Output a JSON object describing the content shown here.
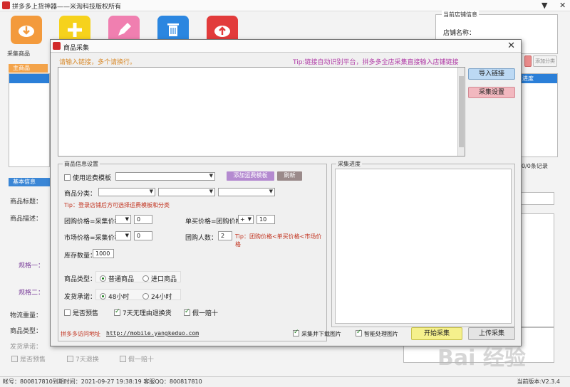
{
  "app": {
    "title": "拼多多上货神器——米淘科技版权所有",
    "minimize_glyph": "▼",
    "close_glyph": "✕"
  },
  "toolbar": {
    "collect_label": "采集商品",
    "colors": {
      "orange": "#f39a3c",
      "yellow": "#f6d21c",
      "pink": "#f07fb0",
      "blue": "#2b86e0",
      "red": "#e23b3b"
    }
  },
  "store_panel": {
    "legend": "当前店铺信息",
    "store_name_label": "店铺名称：",
    "side_btn": "添加分类"
  },
  "left_panel": {
    "tab": "主商品",
    "tab2": "基本信息",
    "labels": {
      "title": "商品标题：",
      "desc": "商品描述：",
      "spec1": "规格一：",
      "spec2": "规格二：",
      "weight": "物流重量：",
      "type": "商品类型：",
      "promise": "发货承诺："
    },
    "bottom_options": [
      "是否预售",
      "7天退换",
      "假一赔十"
    ]
  },
  "right_panel": {
    "header": "进度",
    "records": "0/0条记录"
  },
  "status": {
    "account": "帐号：800817810到期时间：2021-09-27 19:38:19  客服QQ：800817810",
    "version": "当前版本:V2.3.4"
  },
  "dialog": {
    "title": "商品采集",
    "close": "✕",
    "hint": "请输入链接，多个请换行。",
    "tip": "Tip:链接自动识别平台，拼多多全店采集直接输入店铺链接",
    "btn_import": "导入链接",
    "btn_settings": "采集设置",
    "info_group": {
      "legend": "商品信息设置",
      "use_template": "使用运费模板",
      "add_template_btn": "添加运费模板",
      "refresh_btn": "刷新",
      "category_label": "商品分类：",
      "category_tip": "Tip：登录店铺后方可选择运费模板和分类",
      "group_price_label": "团购价格=采集价格",
      "group_price_value": "0",
      "single_price_label": "单买价格=团购价格",
      "single_op": "+",
      "single_value": "10",
      "market_price_label": "市场价格=采集价格",
      "market_value": "0",
      "group_count_label": "团购人数：",
      "group_count_value": "2",
      "price_tip": "Tip：团购价格<单买价格<市场价格",
      "stock_label": "库存数量：",
      "stock_value": "1000",
      "goods_type_label": "商品类型：",
      "goods_type_opt1": "普通商品",
      "goods_type_opt2": "进口商品",
      "ship_label": "发货承诺：",
      "ship_opt1": "48小时",
      "ship_opt2": "24小时",
      "presale": "是否预售",
      "return7": "7天无理由退换货",
      "fake10": "假一赔十"
    },
    "progress_group": {
      "legend": "采集进度"
    },
    "multi_label": "拼多多访问地址",
    "multi_url": "http://mobile.yangkeduo.com",
    "cb_download": "采集并下载图片",
    "cb_smart": "智能处理图片",
    "btn_start": "开始采集",
    "btn_upload": "上传采集"
  },
  "watermark": "Bai 经验"
}
